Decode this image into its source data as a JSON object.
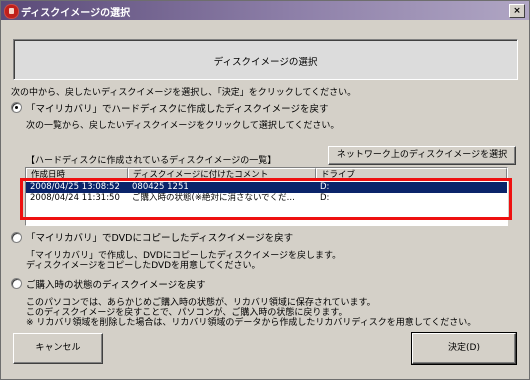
{
  "window": {
    "title": "ディスクイメージの選択",
    "close_glyph": "×"
  },
  "header": {
    "title": "ディスクイメージの選択"
  },
  "instruction": "次の中から、戻したいディスクイメージを選択し、「決定」をクリックしてください。",
  "option1": {
    "label": "「マイリカバリ」でハードディスクに作成したディスクイメージを戻す",
    "sub": "次の一覧から、戻したいディスクイメージをクリックして選択してください。",
    "checked": true
  },
  "list_section": {
    "title": "【ハードディスクに作成されているディスクイメージの一覧】",
    "network_button": "ネットワーク上のディスクイメージを選択",
    "columns": [
      "作成日時",
      "ディスクイメージに付けたコメント",
      "ドライブ"
    ],
    "rows": [
      {
        "date": "2008/04/25 13:08:52",
        "comment": "080425 1251",
        "drive": "D:",
        "selected": true
      },
      {
        "date": "2008/04/24 11:31:50",
        "comment": "ご購入時の状態(※絶対に消さないでくだ...",
        "drive": "D:",
        "selected": false
      }
    ]
  },
  "option2": {
    "label": "「マイリカバリ」でDVDにコピーしたディスクイメージを戻す",
    "desc1": "「マイリカバリ」で作成し、DVDにコピーしたディスクイメージを戻します。",
    "desc2": "ディスクイメージをコピーしたDVDを用意してください。",
    "checked": false
  },
  "option3": {
    "label": "ご購入時の状態のディスクイメージを戻す",
    "desc1": "このパソコンでは、あらかじめご購入時の状態が、リカバリ領域に保存されています。",
    "desc2": "このディスクイメージを戻すことで、パソコンが、ご購入時の状態に戻ります。",
    "desc3": "※ リカバリ領域を削除した場合は、リカバリ領域のデータから作成したリカバリディスクを用意してください。",
    "checked": false
  },
  "buttons": {
    "cancel": "キャンセル",
    "ok": "決定(D)"
  },
  "colors": {
    "selection": "#0a246a",
    "highlight_box": "#ee1010",
    "titlebar": "#5a4a78"
  }
}
